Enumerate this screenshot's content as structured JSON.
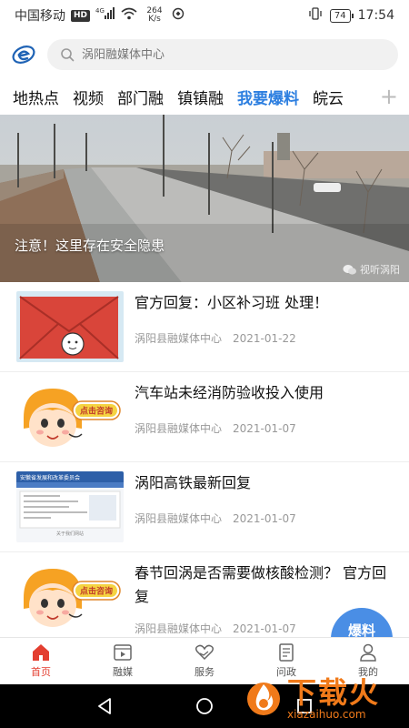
{
  "status_bar": {
    "carrier": "中国移动",
    "hd_badge": "HD",
    "net_type": "4G",
    "speed_value": "264",
    "speed_unit": "K/s",
    "battery": "74",
    "time": "17:54"
  },
  "search": {
    "placeholder": "涡阳融媒体中心"
  },
  "tabs": [
    {
      "label": "地热点",
      "active": false
    },
    {
      "label": "视频",
      "active": false
    },
    {
      "label": "部门融",
      "active": false
    },
    {
      "label": "镇镇融",
      "active": false
    },
    {
      "label": "我要爆料",
      "active": true
    },
    {
      "label": "皖云",
      "active": false
    }
  ],
  "tab_add": "+",
  "hero": {
    "caption": "注意！这里存在安全隐患",
    "watermark": "视听涡阳"
  },
  "news": [
    {
      "title": "官方回复：小区补习班 处理！",
      "source": "涡阳县融媒体中心",
      "date": "2021-01-22",
      "thumb": "envelope"
    },
    {
      "title": "汽车站未经消防验收投入使用",
      "source": "涡阳县融媒体中心",
      "date": "2021-01-07",
      "thumb": "consult",
      "thumb_label": "点击咨询"
    },
    {
      "title": "涡阳高铁最新回复",
      "source": "涡阳县融媒体中心",
      "date": "2021-01-07",
      "thumb": "webpage",
      "thumb_label": "安徽省发展和改革委员会",
      "thumb_sub": "关于我们网站"
    },
    {
      "title": "春节回涡是否需要做核酸检测？ 官方回复",
      "source": "涡阳县融媒体中心",
      "date": "2021-01-07",
      "thumb": "consult",
      "thumb_label": "点击咨询"
    }
  ],
  "fab_label": "爆料",
  "bottom_nav": [
    {
      "label": "首页",
      "icon": "home-icon",
      "active": true
    },
    {
      "label": "融媒",
      "icon": "video-icon",
      "active": false
    },
    {
      "label": "服务",
      "icon": "heart-hand-icon",
      "active": false
    },
    {
      "label": "问政",
      "icon": "document-icon",
      "active": false
    },
    {
      "label": "我的",
      "icon": "user-icon",
      "active": false
    }
  ],
  "download_watermark": {
    "text": "下载火",
    "sub": "xiazaihuo.com"
  },
  "colors": {
    "accent": "#2d7fe0",
    "nav_active": "#e33e30",
    "fab": "#4a8ee5",
    "watermark": "#f07a1a"
  }
}
